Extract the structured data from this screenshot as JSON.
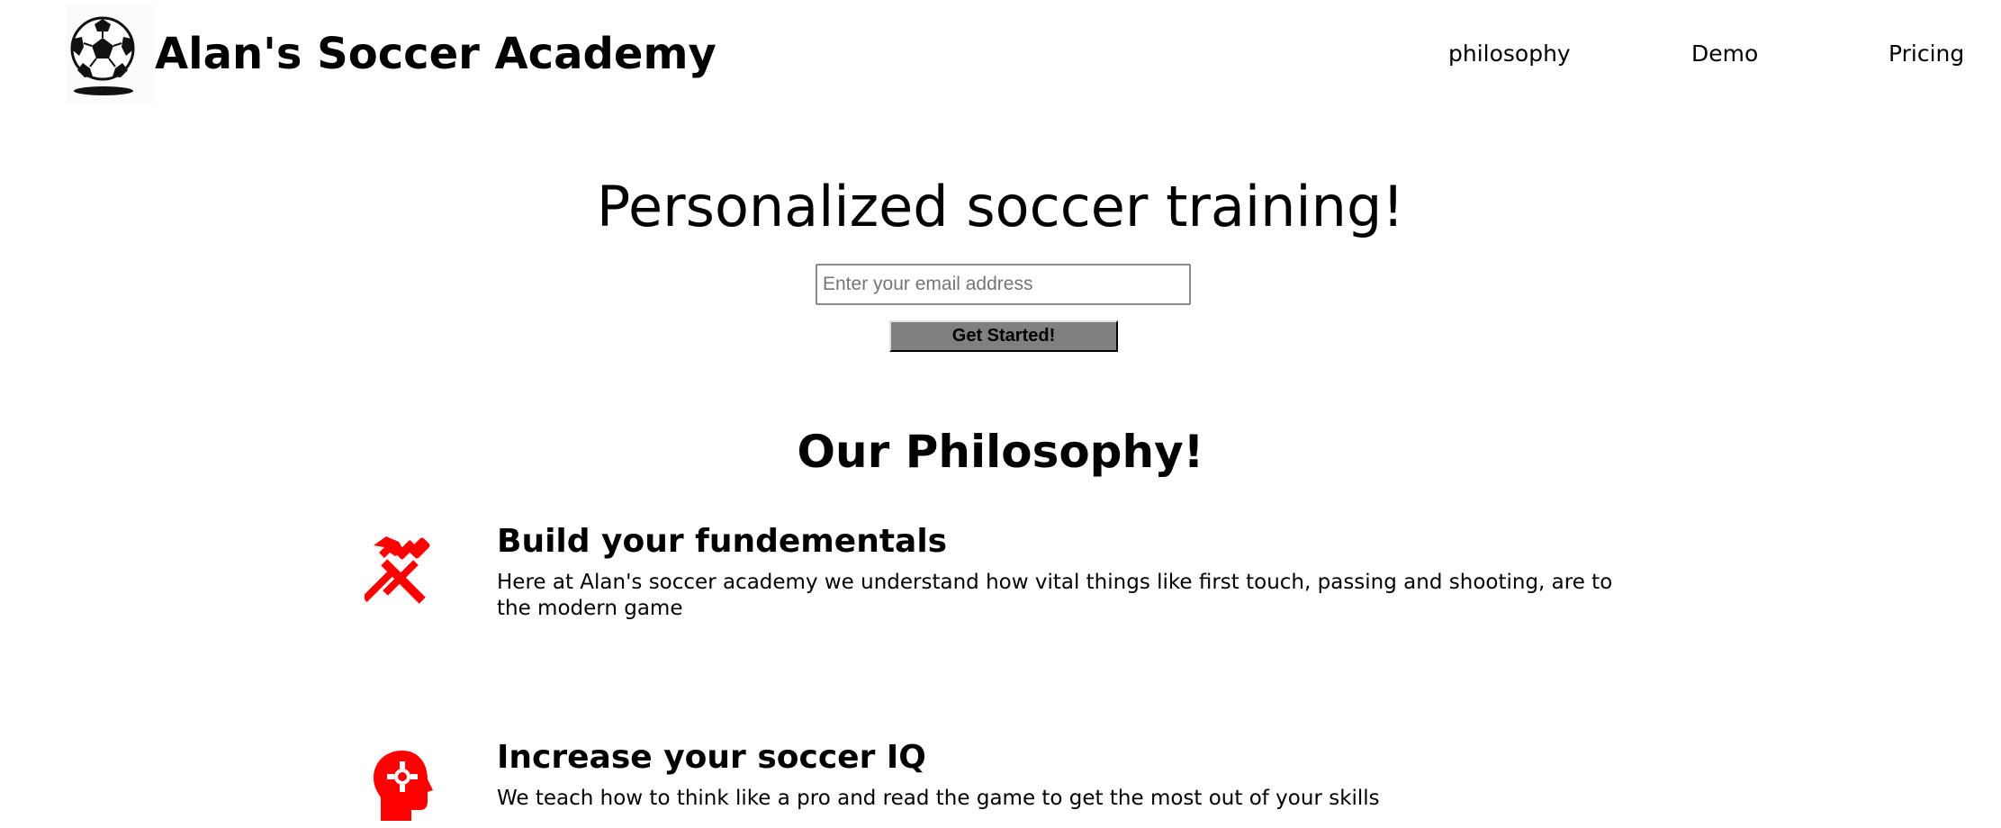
{
  "header": {
    "brand": "Alan's Soccer Academy",
    "logo_icon": "soccer-ball-icon",
    "nav": [
      {
        "label": "philosophy"
      },
      {
        "label": "Demo"
      },
      {
        "label": "Pricing"
      }
    ]
  },
  "hero": {
    "title": "Personalized soccer training!",
    "email_placeholder": "Enter your email address",
    "email_value": "",
    "cta_label": "Get Started!"
  },
  "philosophy": {
    "title": "Our Philosophy!",
    "icon_color": "#ff0000",
    "features": [
      {
        "icon": "tools-icon",
        "title": "Build your fundementals",
        "text": "Here at Alan's soccer academy we understand how vital things like first touch, passing and shooting, are to the modern game"
      },
      {
        "icon": "head-gear-icon",
        "title": "Increase your soccer IQ",
        "text": "We teach how to think like a pro and read the game to get the most out of your skills"
      }
    ]
  }
}
